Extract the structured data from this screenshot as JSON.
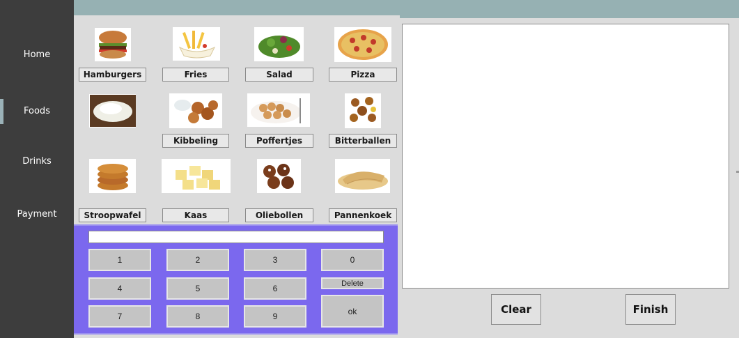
{
  "sidebar": {
    "items": [
      {
        "label": "Home"
      },
      {
        "label": "Foods",
        "active": true
      },
      {
        "label": "Drinks"
      },
      {
        "label": "Payment"
      }
    ]
  },
  "foods": {
    "items": [
      {
        "label": "Hamburgers",
        "icon": "hamburger-image"
      },
      {
        "label": "Fries",
        "icon": "fries-image"
      },
      {
        "label": "Salad",
        "icon": "salad-image"
      },
      {
        "label": "Pizza",
        "icon": "pizza-image"
      },
      {
        "label": "",
        "icon": "rice-image"
      },
      {
        "label": "Kibbeling",
        "icon": "kibbeling-image"
      },
      {
        "label": "Poffertjes",
        "icon": "poffertjes-image"
      },
      {
        "label": "Bitterballen",
        "icon": "bitterballen-image"
      },
      {
        "label": "Stroopwafel",
        "icon": "stroopwafel-image"
      },
      {
        "label": "Kaas",
        "icon": "kaas-image"
      },
      {
        "label": "Oliebollen",
        "icon": "oliebollen-image"
      },
      {
        "label": "Pannenkoek",
        "icon": "pannenkoek-image"
      }
    ]
  },
  "keypad": {
    "display_value": "",
    "keys": [
      "1",
      "2",
      "3",
      "0",
      "4",
      "5",
      "6",
      "Delete",
      "7",
      "8",
      "9",
      "ok"
    ]
  },
  "actions": {
    "clear_label": "Clear",
    "finish_label": "Finish"
  },
  "colors": {
    "sidebar": "#3d3d3d",
    "topbar": "#96b1b3",
    "keypad": "#7b68ee",
    "panel": "#dcdcdc"
  }
}
